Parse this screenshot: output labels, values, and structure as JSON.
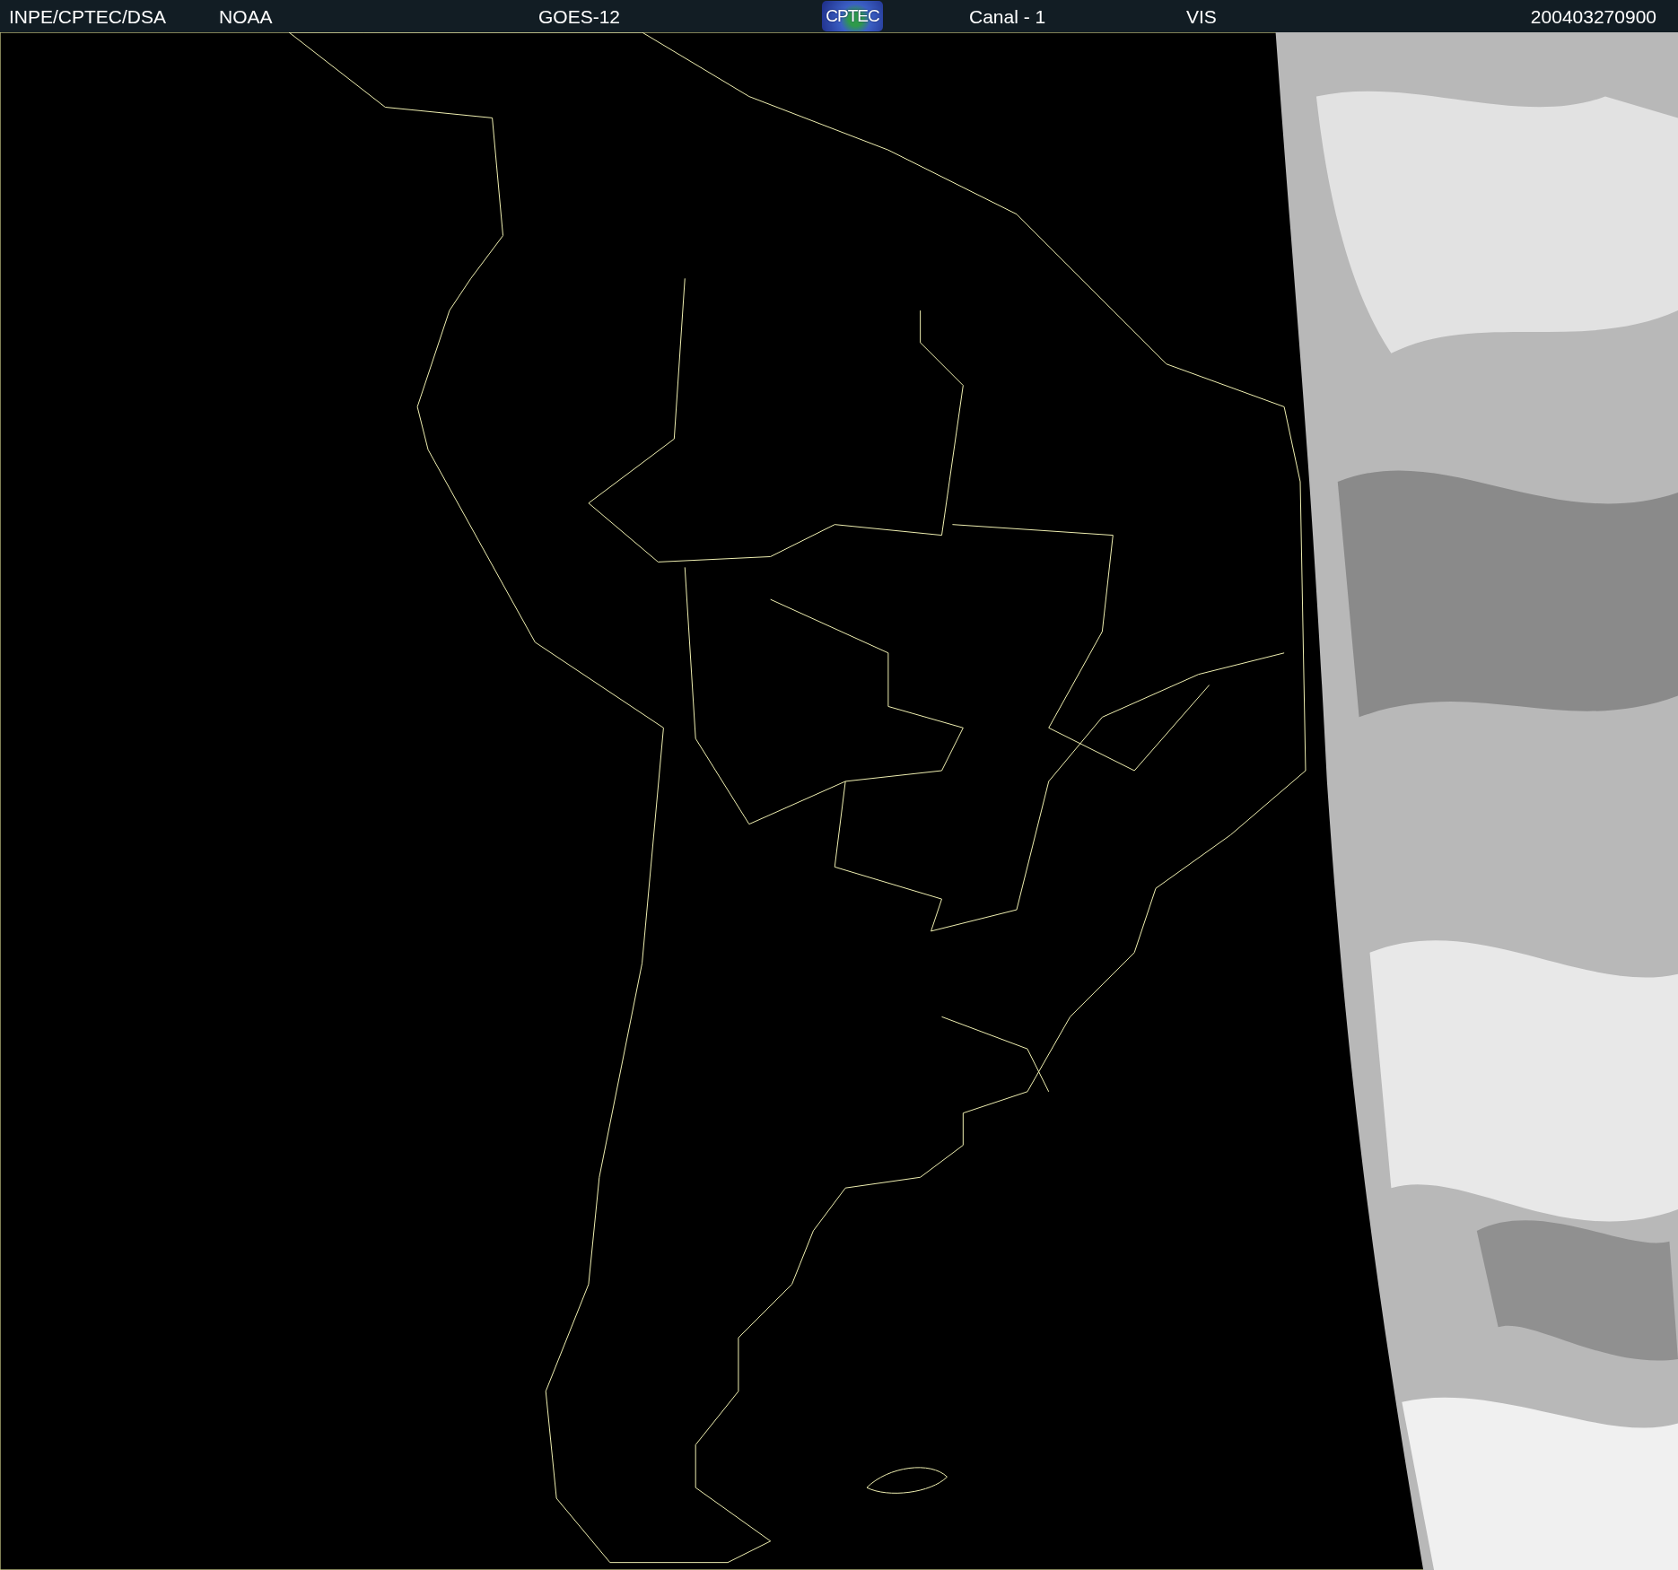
{
  "header": {
    "items": [
      {
        "kind": "text",
        "text": "INPE/CPTEC/DSA"
      },
      {
        "kind": "text",
        "text": "NOAA"
      },
      {
        "kind": "text",
        "text": "GOES-12"
      },
      {
        "kind": "logo",
        "text": "CPTEC"
      },
      {
        "kind": "text",
        "text": "Canal - 1"
      },
      {
        "kind": "text",
        "text": "VIS"
      },
      {
        "kind": "text",
        "text": "200403270900"
      }
    ]
  }
}
